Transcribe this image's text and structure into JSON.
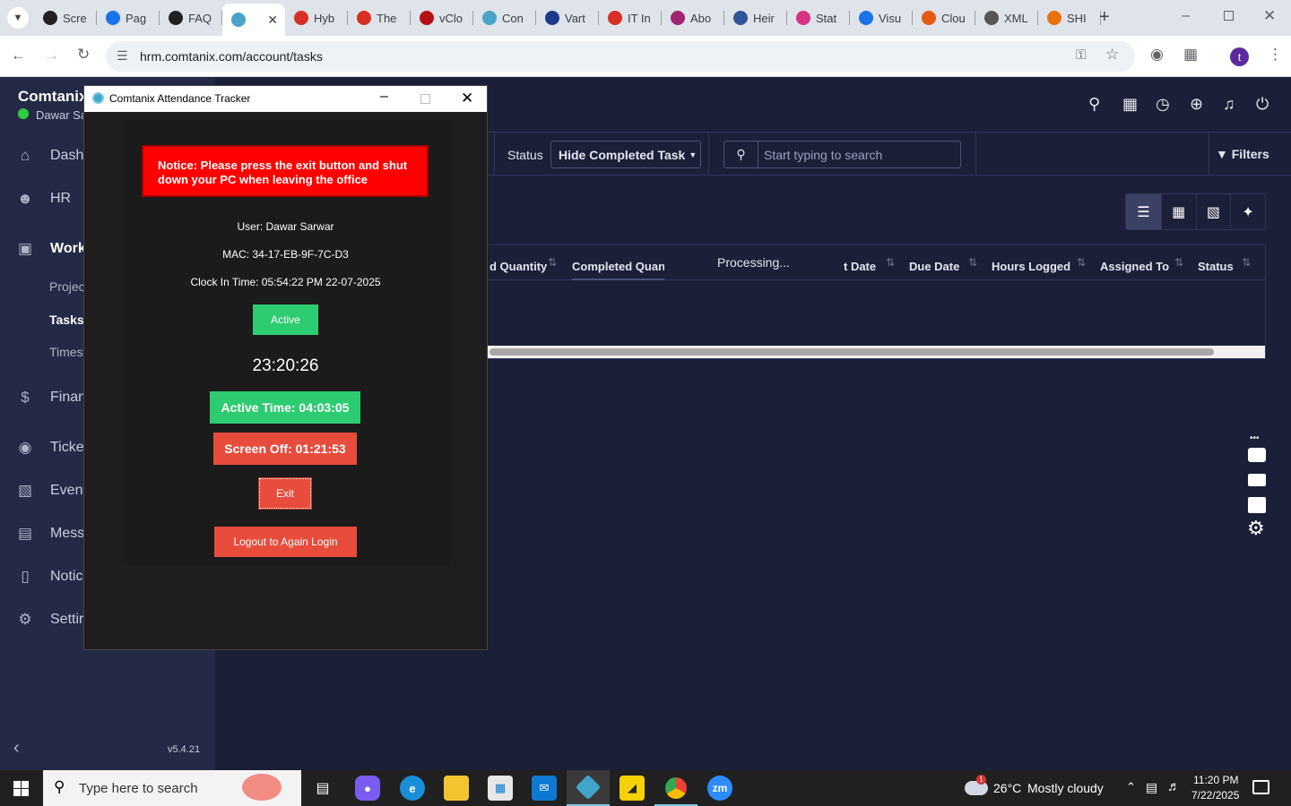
{
  "browser": {
    "tabs": [
      {
        "label": "Scre",
        "color": "#222"
      },
      {
        "label": "Pag",
        "color": "#1a73e8"
      },
      {
        "label": "FAQ",
        "color": "#202124"
      },
      {
        "label": "",
        "color": "#4aa3c8"
      },
      {
        "label": "Hyb",
        "color": "#d93025"
      },
      {
        "label": "The",
        "color": "#d93025"
      },
      {
        "label": "vClo",
        "color": "#b31312"
      },
      {
        "label": "Con",
        "color": "#4aa3c8"
      },
      {
        "label": "Vart",
        "color": "#1e3a8a"
      },
      {
        "label": "IT In",
        "color": "#d93025"
      },
      {
        "label": "Abo",
        "color": "#a0246f"
      },
      {
        "label": "Heir",
        "color": "#2f5597"
      },
      {
        "label": "Stat",
        "color": "#d63384"
      },
      {
        "label": "Visu",
        "color": "#1a73e8"
      },
      {
        "label": "Clou",
        "color": "#e55b13"
      },
      {
        "label": "XML",
        "color": "#555"
      },
      {
        "label": "SHI",
        "color": "#e8710a"
      }
    ],
    "url": "hrm.comtanix.com/account/tasks",
    "profile_initial": "t"
  },
  "sidebar": {
    "brand": "Comtanix",
    "user": "Dawar Sa",
    "items": [
      {
        "label": "Dashl",
        "icon": "home-icon"
      },
      {
        "label": "HR",
        "icon": "users-icon"
      },
      {
        "label": "Work",
        "icon": "briefcase-icon"
      },
      {
        "label": "Finan",
        "icon": "dollar-icon"
      },
      {
        "label": "Ticke",
        "icon": "headset-icon"
      },
      {
        "label": "Event",
        "icon": "calendar-icon"
      },
      {
        "label": "Mess",
        "icon": "message-icon"
      },
      {
        "label": "Notic",
        "icon": "clipboard-icon"
      },
      {
        "label": "Settir",
        "icon": "gear-icon"
      }
    ],
    "subitems": [
      "Projec",
      "Tasks",
      "Times"
    ],
    "version": "v5.4.21"
  },
  "filters": {
    "status_label": "Status",
    "status_value": "Hide Completed Task",
    "search_placeholder": "Start typing to search",
    "filters_label": "Filters"
  },
  "table": {
    "headers": [
      "d Quantity",
      "Completed Quan",
      "t Date",
      "Due Date",
      "Hours Logged",
      "Assigned To",
      "Status"
    ],
    "processing": "Processing..."
  },
  "dialog": {
    "title": "Comtanix Attendance Tracker",
    "notice": "Notice: Please press the exit button and shut down your PC when leaving the office",
    "user": "User: Dawar Sarwar",
    "mac": "MAC: 34-17-EB-9F-7C-D3",
    "clock_in": "Clock In Time: 05:54:22 PM 22-07-2025",
    "status": "Active",
    "timer": "23:20:26",
    "active_time": "Active Time: 04:03:05",
    "screen_off": "Screen Off: 01:21:53",
    "exit": "Exit",
    "logout": "Logout to Again Login"
  },
  "taskbar": {
    "search_placeholder": "Type here to search",
    "weather_temp": "26°C",
    "weather_desc": "Mostly cloudy",
    "weather_badge": "1",
    "time": "11:20 PM",
    "date": "7/22/2025"
  },
  "colors": {
    "app_bg": "#1b2038",
    "sidebar_bg": "#242a45",
    "notice_red": "#ff0000",
    "active_green": "#2ecc71",
    "alert_red": "#e74c3c"
  }
}
